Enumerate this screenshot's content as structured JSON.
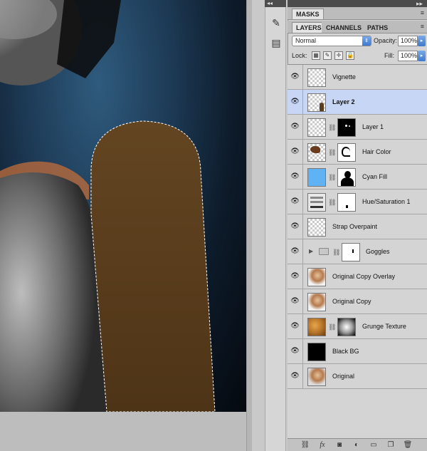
{
  "dock": {
    "collapse_arrows": "◂◂",
    "buttons": [
      {
        "icon": "adjustment-pen-icon",
        "glyph": "✎"
      },
      {
        "icon": "document-stack-icon",
        "glyph": "▤"
      }
    ]
  },
  "panel_header": {
    "collapse_arrows": "▸▸"
  },
  "masks_tab": {
    "label": "MASKS"
  },
  "layers_tabs": [
    {
      "label": "LAYERS",
      "active": true
    },
    {
      "label": "CHANNELS",
      "active": false
    },
    {
      "label": "PATHS",
      "active": false
    }
  ],
  "controls": {
    "blend_mode": "Normal",
    "opacity_label": "Opacity:",
    "opacity_value": "100%",
    "lock_label": "Lock:",
    "fill_label": "Fill:",
    "fill_value": "100%"
  },
  "layers": [
    {
      "name": "Vignette",
      "thumb": "checker",
      "mask": null,
      "visible": true,
      "selected": false
    },
    {
      "name": "Layer 2",
      "thumb": "checker-brown",
      "mask": null,
      "visible": true,
      "selected": true
    },
    {
      "name": "Layer 1",
      "thumb": "checker",
      "mask": "black-dots",
      "visible": true,
      "selected": false
    },
    {
      "name": "Hair Color",
      "thumb": "checker-hair",
      "mask": "white-hair",
      "visible": true,
      "selected": false
    },
    {
      "name": "Cyan Fill",
      "thumb": "cyan",
      "mask": "silhouette",
      "visible": true,
      "selected": false
    },
    {
      "name": "Hue/Saturation 1",
      "thumb": "adjustment",
      "mask": "white-speck",
      "visible": true,
      "selected": false
    },
    {
      "name": "Strap Overpaint",
      "thumb": "checker",
      "mask": null,
      "visible": true,
      "selected": false
    },
    {
      "name": "Goggles",
      "thumb": "folder",
      "mask": "white-speck2",
      "visible": true,
      "selected": false
    },
    {
      "name": "Original Copy Overlay",
      "thumb": "photo",
      "mask": null,
      "visible": true,
      "selected": false
    },
    {
      "name": "Original Copy",
      "thumb": "photo",
      "mask": null,
      "visible": true,
      "selected": false
    },
    {
      "name": "Grunge Texture",
      "thumb": "grunge",
      "mask": "radial",
      "visible": true,
      "selected": false
    },
    {
      "name": "Black BG",
      "thumb": "black",
      "mask": null,
      "visible": true,
      "selected": false
    },
    {
      "name": "Original",
      "thumb": "photo",
      "mask": null,
      "visible": true,
      "selected": false
    }
  ],
  "bottom_bar": [
    "link-icon",
    "fx-icon",
    "add-mask-icon",
    "adjustment-icon",
    "group-icon",
    "new-layer-icon",
    "trash-icon"
  ],
  "canvas": {
    "shape_color": "#5a3d1c",
    "background_color": "#1d3a55"
  }
}
